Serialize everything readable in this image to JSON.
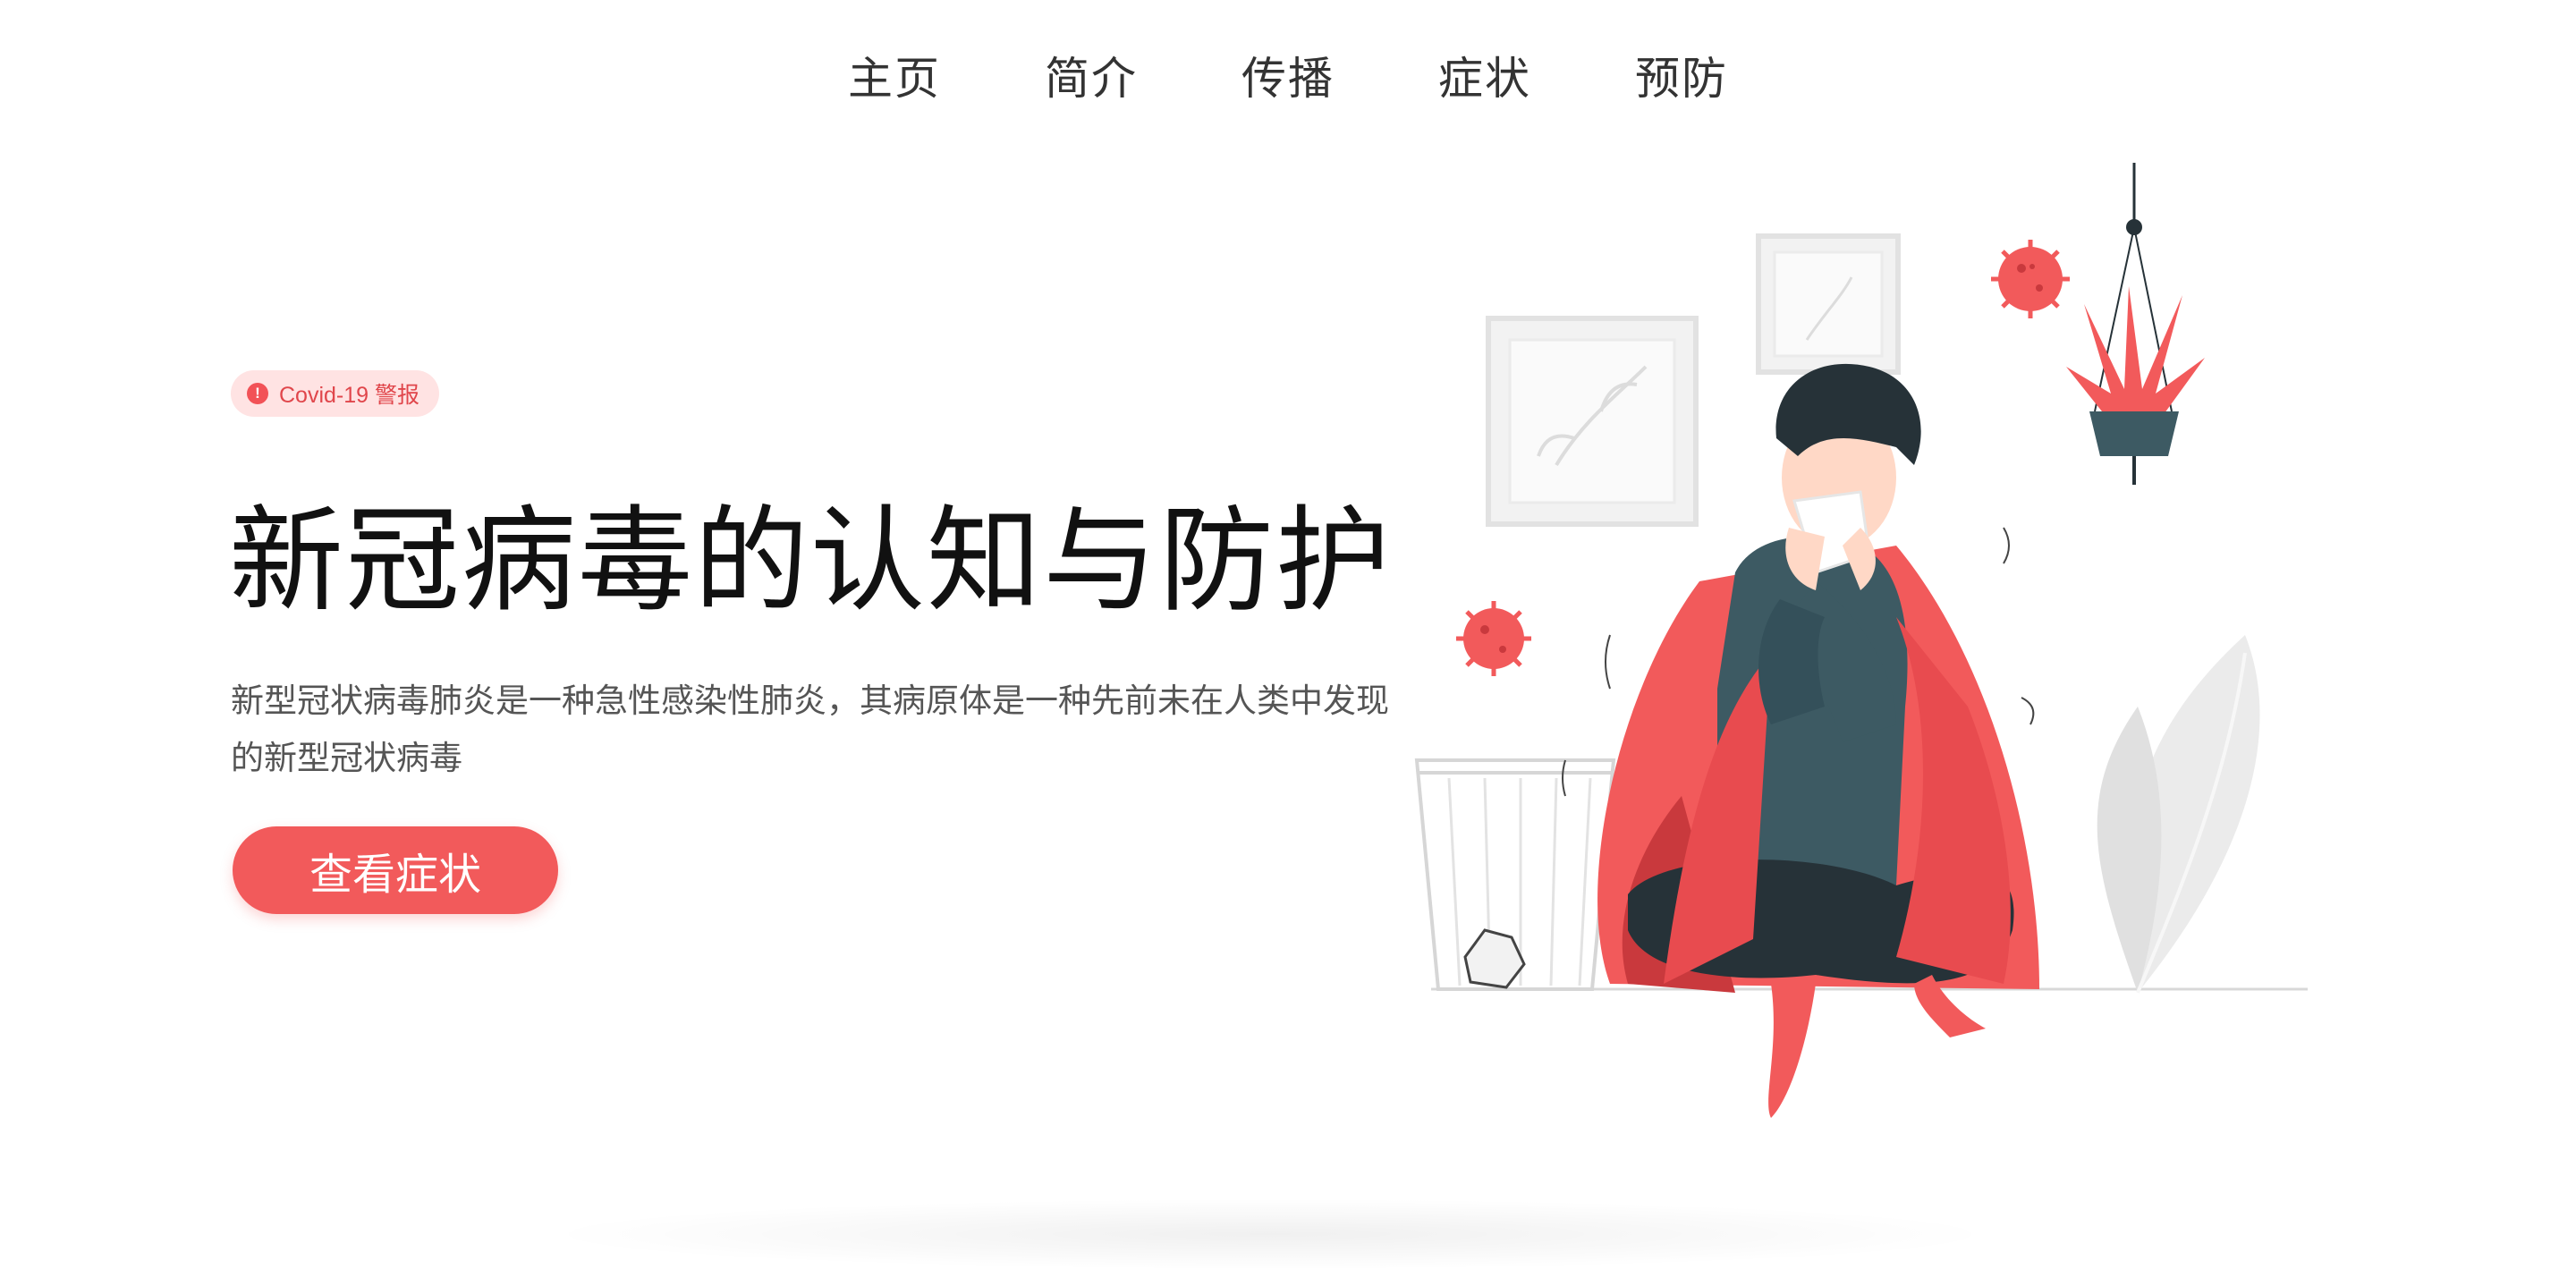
{
  "nav": {
    "items": [
      {
        "label": "主页"
      },
      {
        "label": "简介"
      },
      {
        "label": "传播"
      },
      {
        "label": "症状"
      },
      {
        "label": "预防"
      }
    ]
  },
  "hero": {
    "badge": {
      "icon": "alert-icon",
      "text": "Covid-19 警报"
    },
    "title": "新冠病毒的认知与防护",
    "description": "新型冠状病毒肺炎是一种急性感染性肺炎，其病原体是一种先前未在人类中发现的新型冠状病毒",
    "cta_label": "查看症状"
  },
  "colors": {
    "accent": "#f25a5b",
    "badge_bg": "#ffe3e3",
    "shirt": "#3d5a63",
    "pants": "#263238"
  }
}
